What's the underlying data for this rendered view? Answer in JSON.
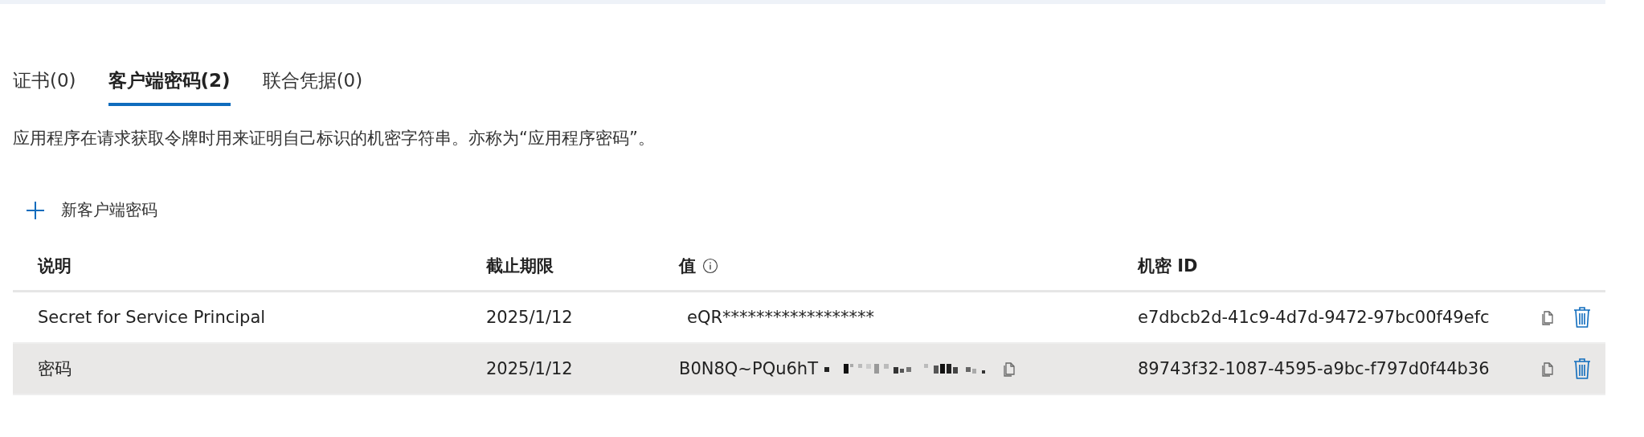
{
  "tabs": [
    {
      "label": "证书(0)",
      "selected": false
    },
    {
      "label": "客户端密码(2)",
      "selected": true
    },
    {
      "label": "联合凭据(0)",
      "selected": false
    }
  ],
  "description": "应用程序在请求获取令牌时用来证明自己标识的机密字符串。亦称为“应用程序密码”。",
  "add_button": "新客户端密码",
  "table": {
    "columns": [
      "说明",
      "截止期限",
      "值",
      "机密 ID"
    ],
    "rows": [
      {
        "description": "Secret for Service Principal",
        "expires": "2025/1/12",
        "value": "eQR******************",
        "value_redacted": false,
        "secret_id": "e7dbcb2d-41c9-4d7d-9472-97bc00f49efc",
        "selected": false
      },
      {
        "description": "密码",
        "expires": "2025/1/12",
        "value": "B0N8Q~PQu6hT",
        "value_redacted": true,
        "secret_id": "89743f32-1087-4595-a9bc-f797d0f44b36",
        "selected": true
      }
    ]
  }
}
